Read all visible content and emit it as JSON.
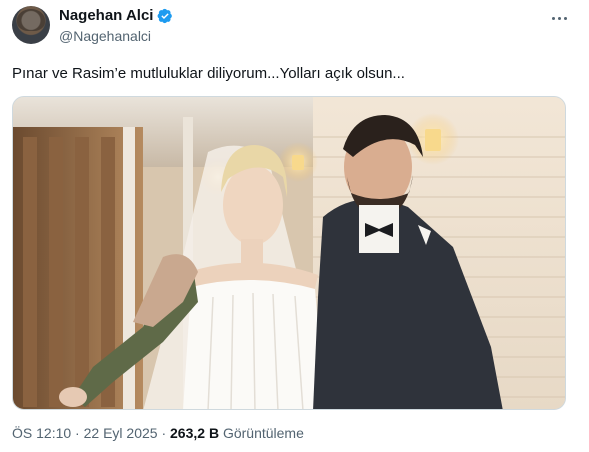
{
  "author": {
    "display_name": "Nagehan Alci",
    "handle": "@Nagehanalci",
    "verified": true,
    "verified_color": "#1d9bf0",
    "avatar_icon": "profile-avatar"
  },
  "more_icon": "more-horizontal-icon",
  "tweet": {
    "text": "Pınar ve Rasim’e mutluluklar diliyorum...Yolları açık olsun..."
  },
  "media": {
    "type": "photo",
    "subject": "wedding-couple-photo"
  },
  "meta": {
    "time": "ÖS 12:10",
    "separator1": " · ",
    "date": "22 Eyl 2025",
    "separator2": " · ",
    "views_count": "263,2 B",
    "views_label": " Görüntüleme"
  }
}
